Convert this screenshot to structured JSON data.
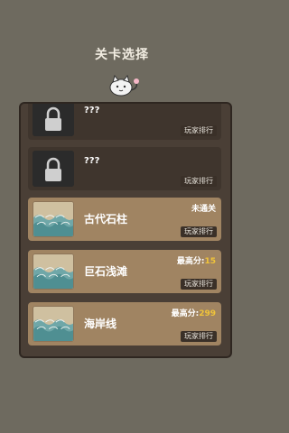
{
  "header": {
    "title": "关卡选择"
  },
  "levels": [
    {
      "name": "???",
      "locked": true,
      "rank_label": "玩家排行"
    },
    {
      "name": "???",
      "locked": true,
      "rank_label": "玩家排行"
    },
    {
      "name": "古代石柱",
      "locked": false,
      "status_text": "未通关",
      "rank_label": "玩家排行"
    },
    {
      "name": "巨石浅滩",
      "locked": false,
      "score_label": "最高分:",
      "score_value": "15",
      "rank_label": "玩家排行"
    },
    {
      "name": "海岸线",
      "locked": false,
      "score_label": "最高分:",
      "score_value": "299",
      "rank_label": "玩家排行"
    }
  ],
  "colors": {
    "background": "#6e6a5f",
    "panel": "#4a3f36",
    "card_open": "#a08462",
    "highlight": "#f0c43a"
  }
}
